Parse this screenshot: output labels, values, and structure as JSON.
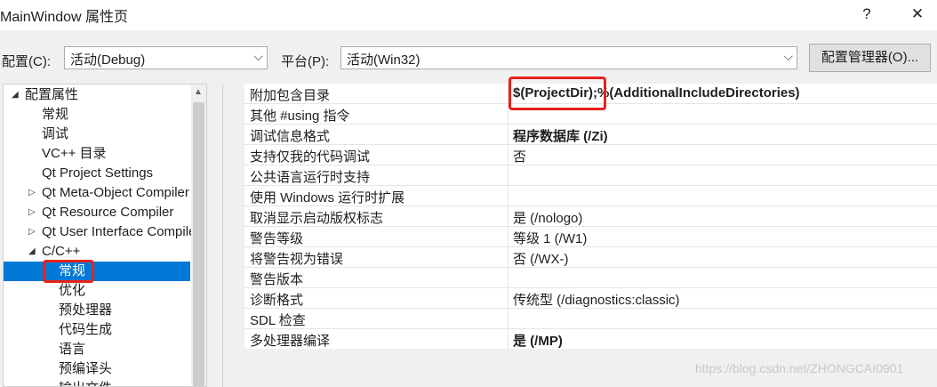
{
  "window": {
    "title": "MainWindow 属性页",
    "help_glyph": "?",
    "close_glyph": "✕"
  },
  "config": {
    "config_label": "配置(C):",
    "config_value": "活动(Debug)",
    "platform_label": "平台(P):",
    "platform_value": "活动(Win32)",
    "manager_button": "配置管理器(O)..."
  },
  "tree": {
    "items": [
      {
        "label": "配置属性",
        "expander": "◢",
        "indent": 0
      },
      {
        "label": "常规",
        "expander": "",
        "indent": 1
      },
      {
        "label": "调试",
        "expander": "",
        "indent": 1
      },
      {
        "label": "VC++ 目录",
        "expander": "",
        "indent": 1
      },
      {
        "label": "Qt Project Settings",
        "expander": "",
        "indent": 1
      },
      {
        "label": "Qt Meta-Object Compiler",
        "expander": "▷",
        "indent": 1
      },
      {
        "label": "Qt Resource Compiler",
        "expander": "▷",
        "indent": 1
      },
      {
        "label": "Qt User Interface Compiler",
        "expander": "▷",
        "indent": 1
      },
      {
        "label": "C/C++",
        "expander": "◢",
        "indent": 1
      },
      {
        "label": "常规",
        "expander": "",
        "indent": 2,
        "selected": true
      },
      {
        "label": "优化",
        "expander": "",
        "indent": 2
      },
      {
        "label": "预处理器",
        "expander": "",
        "indent": 2
      },
      {
        "label": "代码生成",
        "expander": "",
        "indent": 2
      },
      {
        "label": "语言",
        "expander": "",
        "indent": 2
      },
      {
        "label": "预编译头",
        "expander": "",
        "indent": 2
      },
      {
        "label": "输出文件",
        "expander": "",
        "indent": 2
      }
    ]
  },
  "properties": [
    {
      "name": "附加包含目录",
      "value": "$(ProjectDir);%(AdditionalIncludeDirectories)",
      "bold": true
    },
    {
      "name": "其他 #using 指令",
      "value": "",
      "bold": false
    },
    {
      "name": "调试信息格式",
      "value": "程序数据库 (/Zi)",
      "bold": true
    },
    {
      "name": "支持仅我的代码调试",
      "value": "否",
      "bold": false
    },
    {
      "name": "公共语言运行时支持",
      "value": "",
      "bold": false
    },
    {
      "name": "使用 Windows 运行时扩展",
      "value": "",
      "bold": false
    },
    {
      "name": "取消显示启动版权标志",
      "value": "是 (/nologo)",
      "bold": false
    },
    {
      "name": "警告等级",
      "value": "等级 1 (/W1)",
      "bold": false
    },
    {
      "name": "将警告视为错误",
      "value": "否 (/WX-)",
      "bold": false
    },
    {
      "name": "警告版本",
      "value": "",
      "bold": false
    },
    {
      "name": "诊断格式",
      "value": "传统型 (/diagnostics:classic)",
      "bold": false
    },
    {
      "name": "SDL 检查",
      "value": "",
      "bold": false
    },
    {
      "name": "多处理器编译",
      "value": "是 (/MP)",
      "bold": true
    }
  ],
  "watermark": "https://blog.csdn.net/ZHONGCAI0901",
  "colors": {
    "selection": "#0078d7",
    "highlight_box": "#e8221b"
  }
}
